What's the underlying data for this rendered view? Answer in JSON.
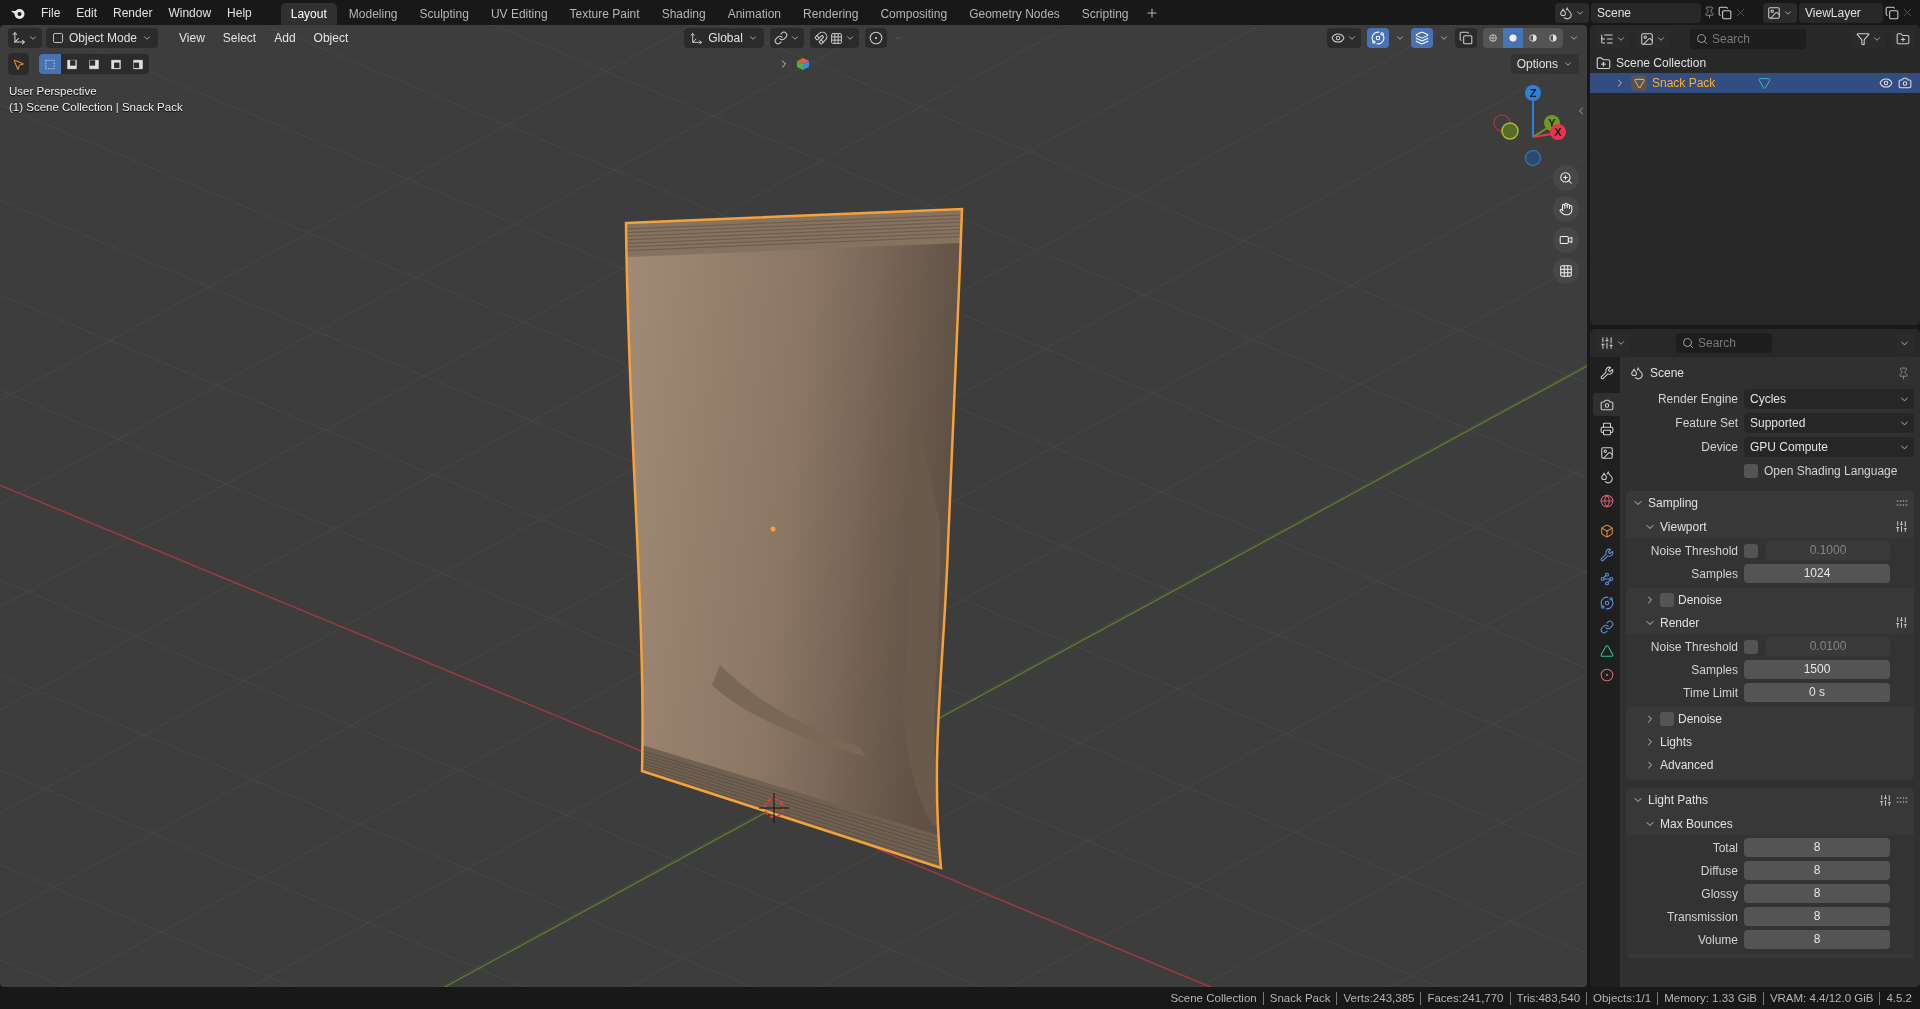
{
  "top_bar": {
    "menus": [
      "File",
      "Edit",
      "Render",
      "Window",
      "Help"
    ],
    "workspaces": [
      {
        "label": "Layout",
        "selected": true
      },
      {
        "label": "Modeling",
        "selected": false
      },
      {
        "label": "Sculpting",
        "selected": false
      },
      {
        "label": "UV Editing",
        "selected": false
      },
      {
        "label": "Texture Paint",
        "selected": false
      },
      {
        "label": "Shading",
        "selected": false
      },
      {
        "label": "Animation",
        "selected": false
      },
      {
        "label": "Rendering",
        "selected": false
      },
      {
        "label": "Compositing",
        "selected": false
      },
      {
        "label": "Geometry Nodes",
        "selected": false
      },
      {
        "label": "Scripting",
        "selected": false
      }
    ],
    "scene": "Scene",
    "view_layer": "ViewLayer"
  },
  "viewport": {
    "mode": "Object Mode",
    "menus": [
      "View",
      "Select",
      "Add",
      "Object"
    ],
    "orientation": "Global",
    "options": "Options",
    "select_modes": [
      {
        "selected": true
      },
      {
        "selected": false
      },
      {
        "selected": false
      },
      {
        "selected": false
      },
      {
        "selected": false
      }
    ],
    "gizmos_on": true,
    "overlays_on": true,
    "shading_modes": [
      {
        "selected": false
      },
      {
        "selected": true
      },
      {
        "selected": false
      },
      {
        "selected": false
      }
    ],
    "info": [
      "User Perspective",
      "(1) Scene Collection | Snack Pack"
    ],
    "gizmo": [
      {
        "label": "Z",
        "color": "#2f80d8"
      },
      {
        "label": "Y",
        "color": "#6c9c22"
      },
      {
        "label": "X",
        "color": "#e8364f"
      }
    ]
  },
  "outliner": {
    "search": {
      "placeholder": "Search"
    },
    "items": [
      {
        "label": "Scene Collection",
        "selected": false,
        "children": [
          {
            "label": "Snack Pack",
            "selected": true,
            "expanded": false
          }
        ]
      }
    ]
  },
  "properties": {
    "search": {
      "placeholder": "Search"
    },
    "tabs": [
      {
        "selected": false
      },
      {
        "selected": true
      },
      {
        "selected": false
      },
      {
        "selected": false
      },
      {
        "selected": false
      },
      {
        "selected": false
      },
      {
        "selected": false
      },
      {
        "selected": false
      },
      {
        "selected": false
      },
      {
        "selected": false
      },
      {
        "selected": false
      },
      {
        "selected": false
      },
      {
        "selected": false
      }
    ],
    "context": "Scene",
    "fields": [
      {
        "label": "Render Engine",
        "value": "Cycles"
      },
      {
        "label": "Feature Set",
        "value": "Supported"
      },
      {
        "label": "Device",
        "value": "GPU Compute"
      }
    ],
    "option": {
      "label": "Open Shading Language",
      "checked": false
    },
    "panels": [
      {
        "title": "Sampling",
        "expanded": true,
        "children": [
          {
            "title": "Viewport",
            "expanded": true,
            "presets": true,
            "rows": [
              {
                "kind": "threshold",
                "label": "Noise Threshold",
                "checked": false,
                "value": "0.1000"
              },
              {
                "kind": "number",
                "label": "Samples",
                "value": "1024"
              }
            ]
          },
          {
            "title": "Denoise",
            "expanded": false,
            "checked": false
          },
          {
            "title": "Render",
            "expanded": true,
            "presets": true,
            "rows": [
              {
                "kind": "threshold",
                "label": "Noise Threshold",
                "checked": false,
                "value": "0.0100"
              },
              {
                "kind": "number",
                "label": "Samples",
                "value": "1500"
              },
              {
                "kind": "number",
                "label": "Time Limit",
                "value": "0 s"
              }
            ]
          },
          {
            "title": "Denoise",
            "expanded": false,
            "checked": false
          },
          {
            "title": "Lights",
            "expanded": false
          },
          {
            "title": "Advanced",
            "expanded": false
          }
        ]
      },
      {
        "title": "Light Paths",
        "expanded": true,
        "presets": true,
        "children": [
          {
            "title": "Max Bounces",
            "expanded": true,
            "rows": [
              {
                "kind": "number",
                "label": "Total",
                "value": "8"
              },
              {
                "kind": "number",
                "label": "Diffuse",
                "value": "8"
              },
              {
                "kind": "number",
                "label": "Glossy",
                "value": "8"
              },
              {
                "kind": "number",
                "label": "Transmission",
                "value": "8"
              },
              {
                "kind": "number",
                "label": "Volume",
                "value": "8"
              }
            ]
          }
        ]
      }
    ]
  },
  "status_bar": [
    "Scene Collection",
    "Snack Pack",
    "Verts:243,385",
    "Faces:241,770",
    "Tris:483,540",
    "Objects:1/1",
    "Memory: 1.33 GiB",
    "VRAM: 4.4/12.0 GiB",
    "4.5.2"
  ]
}
